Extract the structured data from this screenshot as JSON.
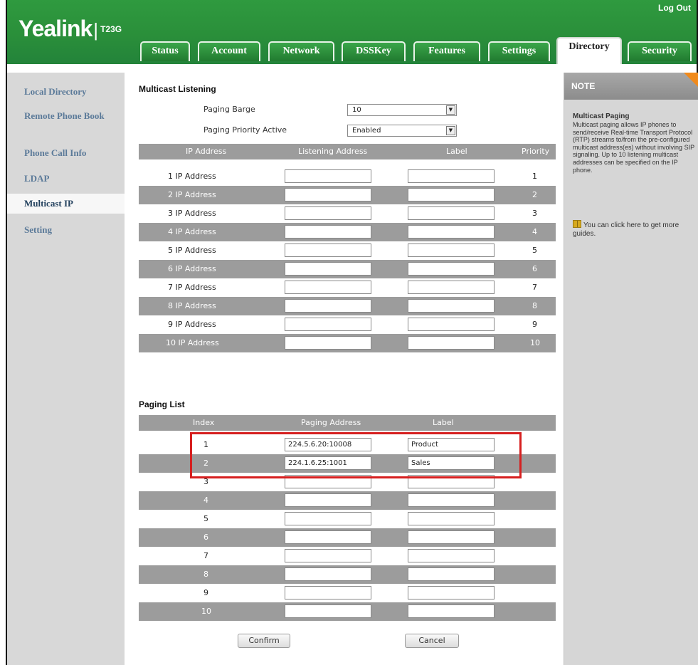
{
  "header": {
    "logo_brand": "Yealink",
    "logo_sep": "|",
    "logo_model": "T23G",
    "logout_label": "Log Out"
  },
  "tabs": [
    {
      "label": "Status"
    },
    {
      "label": "Account"
    },
    {
      "label": "Network"
    },
    {
      "label": "DSSKey"
    },
    {
      "label": "Features"
    },
    {
      "label": "Settings"
    },
    {
      "label": "Directory",
      "active": true
    },
    {
      "label": "Security"
    }
  ],
  "sidebar": {
    "items": [
      {
        "label": "Local Directory"
      },
      {
        "label": "Remote Phone Book"
      },
      {
        "label": "Phone Call Info"
      },
      {
        "label": "LDAP"
      },
      {
        "label": "Multicast IP",
        "active": true
      },
      {
        "label": "Setting"
      }
    ]
  },
  "multicast": {
    "title": "Multicast Listening",
    "paging_barge_label": "Paging Barge",
    "paging_barge_value": "10",
    "paging_priority_label": "Paging Priority Active",
    "paging_priority_value": "Enabled",
    "columns": {
      "ip": "IP Address",
      "listening": "Listening Address",
      "label": "Label",
      "priority": "Priority"
    },
    "rows": [
      {
        "name": "1 IP Address",
        "address": "",
        "label": "",
        "priority": "1"
      },
      {
        "name": "2 IP Address",
        "address": "",
        "label": "",
        "priority": "2"
      },
      {
        "name": "3 IP Address",
        "address": "",
        "label": "",
        "priority": "3"
      },
      {
        "name": "4 IP Address",
        "address": "",
        "label": "",
        "priority": "4"
      },
      {
        "name": "5 IP Address",
        "address": "",
        "label": "",
        "priority": "5"
      },
      {
        "name": "6 IP Address",
        "address": "",
        "label": "",
        "priority": "6"
      },
      {
        "name": "7 IP Address",
        "address": "",
        "label": "",
        "priority": "7"
      },
      {
        "name": "8 IP Address",
        "address": "",
        "label": "",
        "priority": "8"
      },
      {
        "name": "9 IP Address",
        "address": "",
        "label": "",
        "priority": "9"
      },
      {
        "name": "10 IP Address",
        "address": "",
        "label": "",
        "priority": "10"
      }
    ]
  },
  "paging": {
    "title": "Paging List",
    "columns": {
      "index": "Index",
      "address": "Paging Address",
      "label": "Label"
    },
    "rows": [
      {
        "index": "1",
        "address": "224.5.6.20:10008",
        "label": "Product"
      },
      {
        "index": "2",
        "address": "224.1.6.25:1001",
        "label": "Sales"
      },
      {
        "index": "3",
        "address": "",
        "label": ""
      },
      {
        "index": "4",
        "address": "",
        "label": ""
      },
      {
        "index": "5",
        "address": "",
        "label": ""
      },
      {
        "index": "6",
        "address": "",
        "label": ""
      },
      {
        "index": "7",
        "address": "",
        "label": ""
      },
      {
        "index": "8",
        "address": "",
        "label": ""
      },
      {
        "index": "9",
        "address": "",
        "label": ""
      },
      {
        "index": "10",
        "address": "",
        "label": ""
      }
    ]
  },
  "buttons": {
    "confirm": "Confirm",
    "cancel": "Cancel"
  },
  "note": {
    "header": "NOTE",
    "title": "Multicast Paging",
    "body": "Multicast paging allows IP phones to send/receive Real-time Transport Protocol (RTP) streams to/from the pre-configured multicast address(es) without involving SIP signaling. Up to 10 listening multicast addresses can be specified on the IP phone.",
    "guide": "You can click here to get more guides."
  },
  "colors": {
    "header_green": "#2a8f3a",
    "highlight_red": "#d61f1f",
    "note_accent": "#f08a1c"
  }
}
